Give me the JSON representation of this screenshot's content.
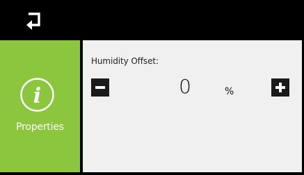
{
  "header": {
    "back_icon": "return-arrow-icon"
  },
  "sidebar": {
    "icon": "info-circle-icon",
    "label": "Properties"
  },
  "setting": {
    "label": "Humidity Offset:",
    "value": "0",
    "unit": "%",
    "decrement_icon": "minus-icon",
    "increment_icon": "plus-icon"
  },
  "colors": {
    "accent": "#8cc63f",
    "background": "#000000",
    "panel": "#f0f0f0",
    "button": "#1a1a1a"
  }
}
